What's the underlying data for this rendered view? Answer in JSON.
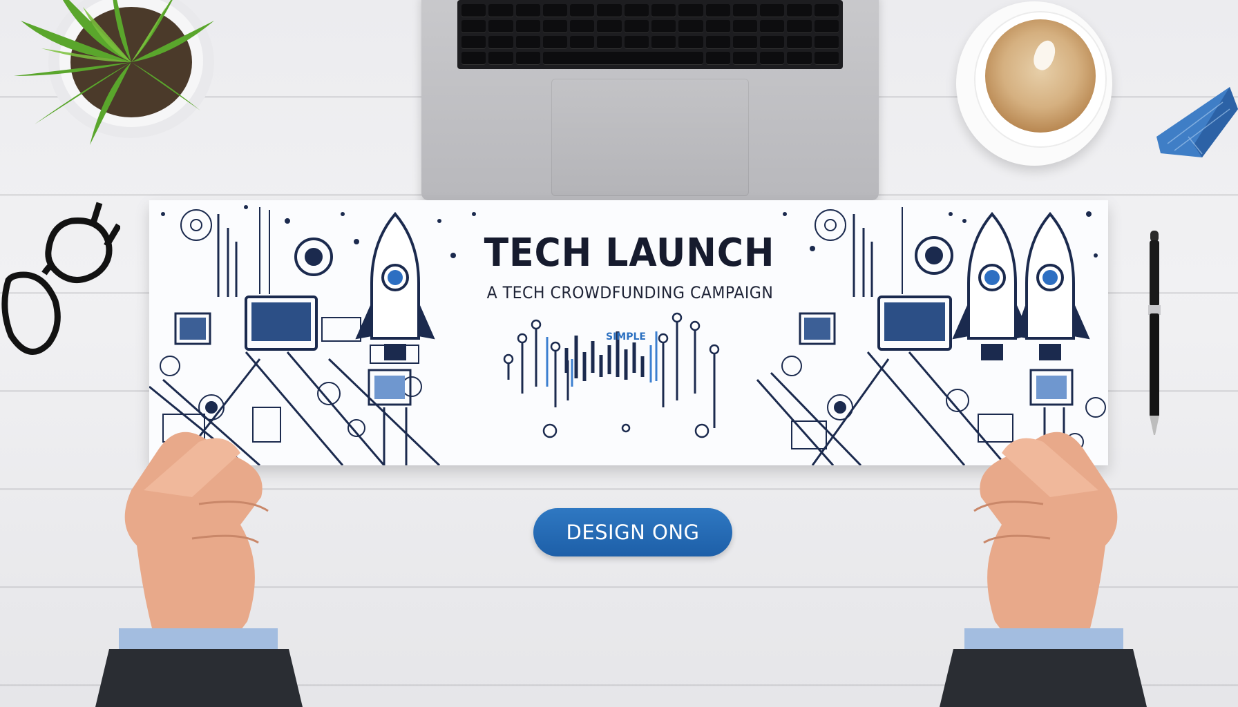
{
  "banner": {
    "title": "TECH LAUNCH",
    "subtitle": "A TECH CROWDFUNDING CAMPAIGN",
    "small_label": "SIMPLE"
  },
  "button": {
    "label": "DESIGN ONG"
  },
  "colors": {
    "accent_blue": "#2f78c2",
    "banner_ink": "#1b2a4e",
    "desk": "#ececef"
  }
}
